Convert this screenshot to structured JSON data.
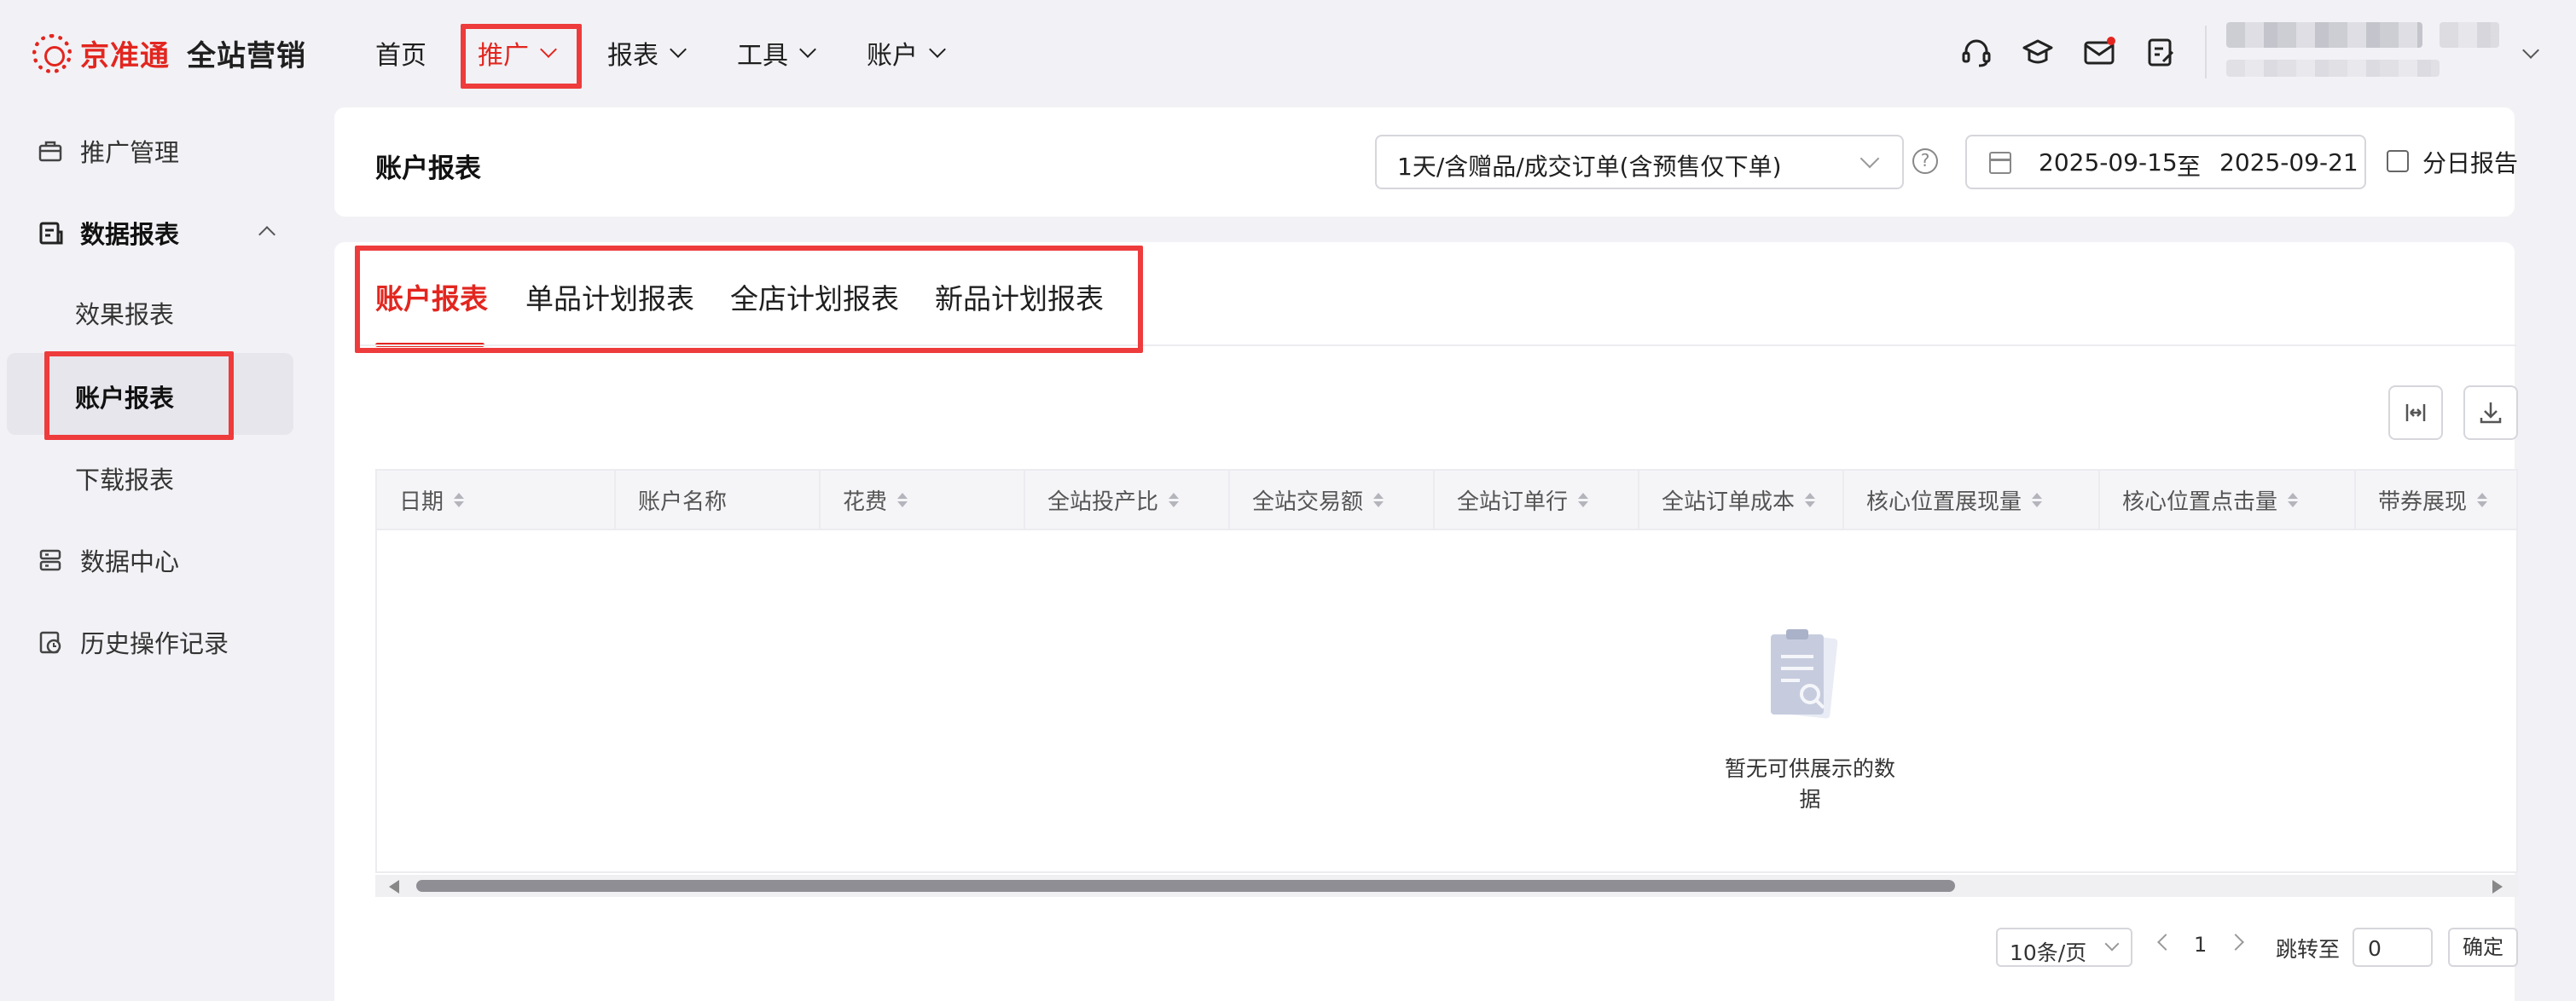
{
  "brand": {
    "name": "京准通",
    "product": "全站营销"
  },
  "nav": {
    "items": [
      {
        "label": "首页"
      },
      {
        "label": "推广"
      },
      {
        "label": "报表"
      },
      {
        "label": "工具"
      },
      {
        "label": "账户"
      }
    ]
  },
  "toolbar_icons": [
    "headset-icon",
    "graduation-cap-icon",
    "mail-icon",
    "task-edit-icon"
  ],
  "sidebar": {
    "items": [
      {
        "label": "推广管理"
      },
      {
        "label": "数据报表"
      },
      {
        "label": "数据中心"
      },
      {
        "label": "历史操作记录"
      }
    ],
    "sub_items": [
      {
        "label": "效果报表"
      },
      {
        "label": "账户报表"
      },
      {
        "label": "下载报表"
      }
    ]
  },
  "header": {
    "title": "账户报表",
    "attribution_select": "1天/含赠品/成交订单(含预售仅下单)",
    "date_start": "2025-09-15",
    "date_sep": "至",
    "date_end": "2025-09-21",
    "daily_report_label": "分日报告"
  },
  "tabs": [
    {
      "label": "账户报表"
    },
    {
      "label": "单品计划报表"
    },
    {
      "label": "全店计划报表"
    },
    {
      "label": "新品计划报表"
    }
  ],
  "table": {
    "columns": [
      {
        "label": "日期"
      },
      {
        "label": "账户名称"
      },
      {
        "label": "花费"
      },
      {
        "label": "全站投产比"
      },
      {
        "label": "全站交易额"
      },
      {
        "label": "全站订单行"
      },
      {
        "label": "全站订单成本"
      },
      {
        "label": "核心位置展现量"
      },
      {
        "label": "核心位置点击量"
      },
      {
        "label": "带券展现"
      }
    ],
    "empty_text": "暂无可供展示的数据"
  },
  "pagination": {
    "page_size": "10条/页",
    "current_page": "1",
    "jump_label": "跳转至",
    "jump_value": "0",
    "confirm_label": "确定"
  },
  "colors": {
    "brand_red": "#e2261f",
    "highlight": "#ee3b3b",
    "background": "#f2f2f6"
  }
}
